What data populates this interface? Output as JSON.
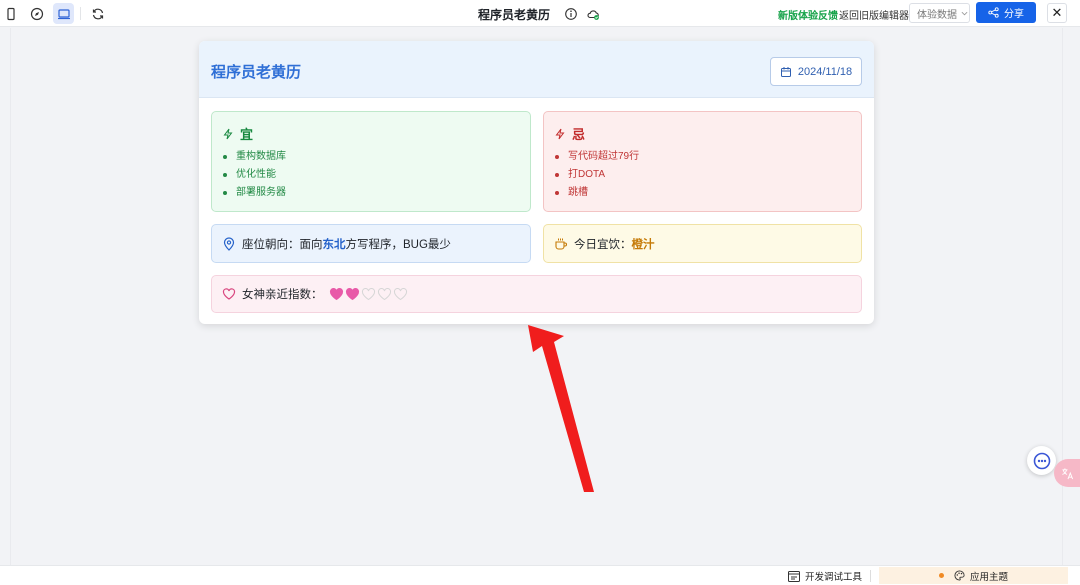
{
  "toolbar": {
    "title": "程序员老黄历",
    "feedback_label": "新版体验反馈",
    "back_label": "返回旧版编辑器",
    "data_select_label": "体验数据",
    "share_label": "分享",
    "close_label": "✕"
  },
  "card": {
    "title": "程序员老黄历",
    "date": "2024/11/18",
    "yi": {
      "label": "宜",
      "items": [
        "重构数据库",
        "优化性能",
        "部署服务器"
      ]
    },
    "ji": {
      "label": "忌",
      "items": [
        "写代码超过79行",
        "打DOTA",
        "跳槽"
      ]
    },
    "seat": {
      "prefix": "座位朝向：面向",
      "direction": "东北",
      "suffix": "方写程序，BUG最少"
    },
    "drink": {
      "prefix": "今日宜饮：",
      "value": "橙汁"
    },
    "goddess": {
      "label": "女神亲近指数：",
      "filled": 2,
      "total": 5
    }
  },
  "bottombar": {
    "dev_tools_label": "开发调试工具",
    "theme_label": "应用主题"
  },
  "colors": {
    "accent": "#1663e8",
    "title_blue": "#2f6fd6",
    "yi_green": "#17883f",
    "ji_red": "#c22b2b",
    "heart_pink": "#e85aa8",
    "arrow_red": "#f01d1d"
  }
}
